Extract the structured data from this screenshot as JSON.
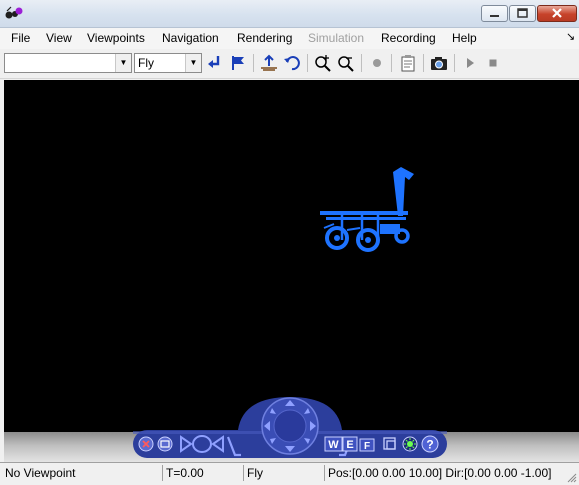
{
  "menu": {
    "file": "File",
    "view": "View",
    "viewpoints": "Viewpoints",
    "navigation": "Navigation",
    "rendering": "Rendering",
    "simulation": "Simulation",
    "recording": "Recording",
    "help": "Help"
  },
  "toolbar": {
    "viewpoint_select": {
      "value": ""
    },
    "nav_mode_select": {
      "value": "Fly"
    }
  },
  "nav_panel": {
    "w_button": "W",
    "e_button": "E",
    "f_button": "F",
    "help_button": "?"
  },
  "statusbar": {
    "viewpoint": "No Viewpoint",
    "time": "T=0.00",
    "mode": "Fly",
    "pos_dir": "Pos:[0.00 0.00 10.00] Dir:[0.00 0.00 -1.00]"
  },
  "colors": {
    "model": "#1e73ff",
    "nav_panel": "#2c3e9c",
    "viewport_bg": "#000000"
  }
}
